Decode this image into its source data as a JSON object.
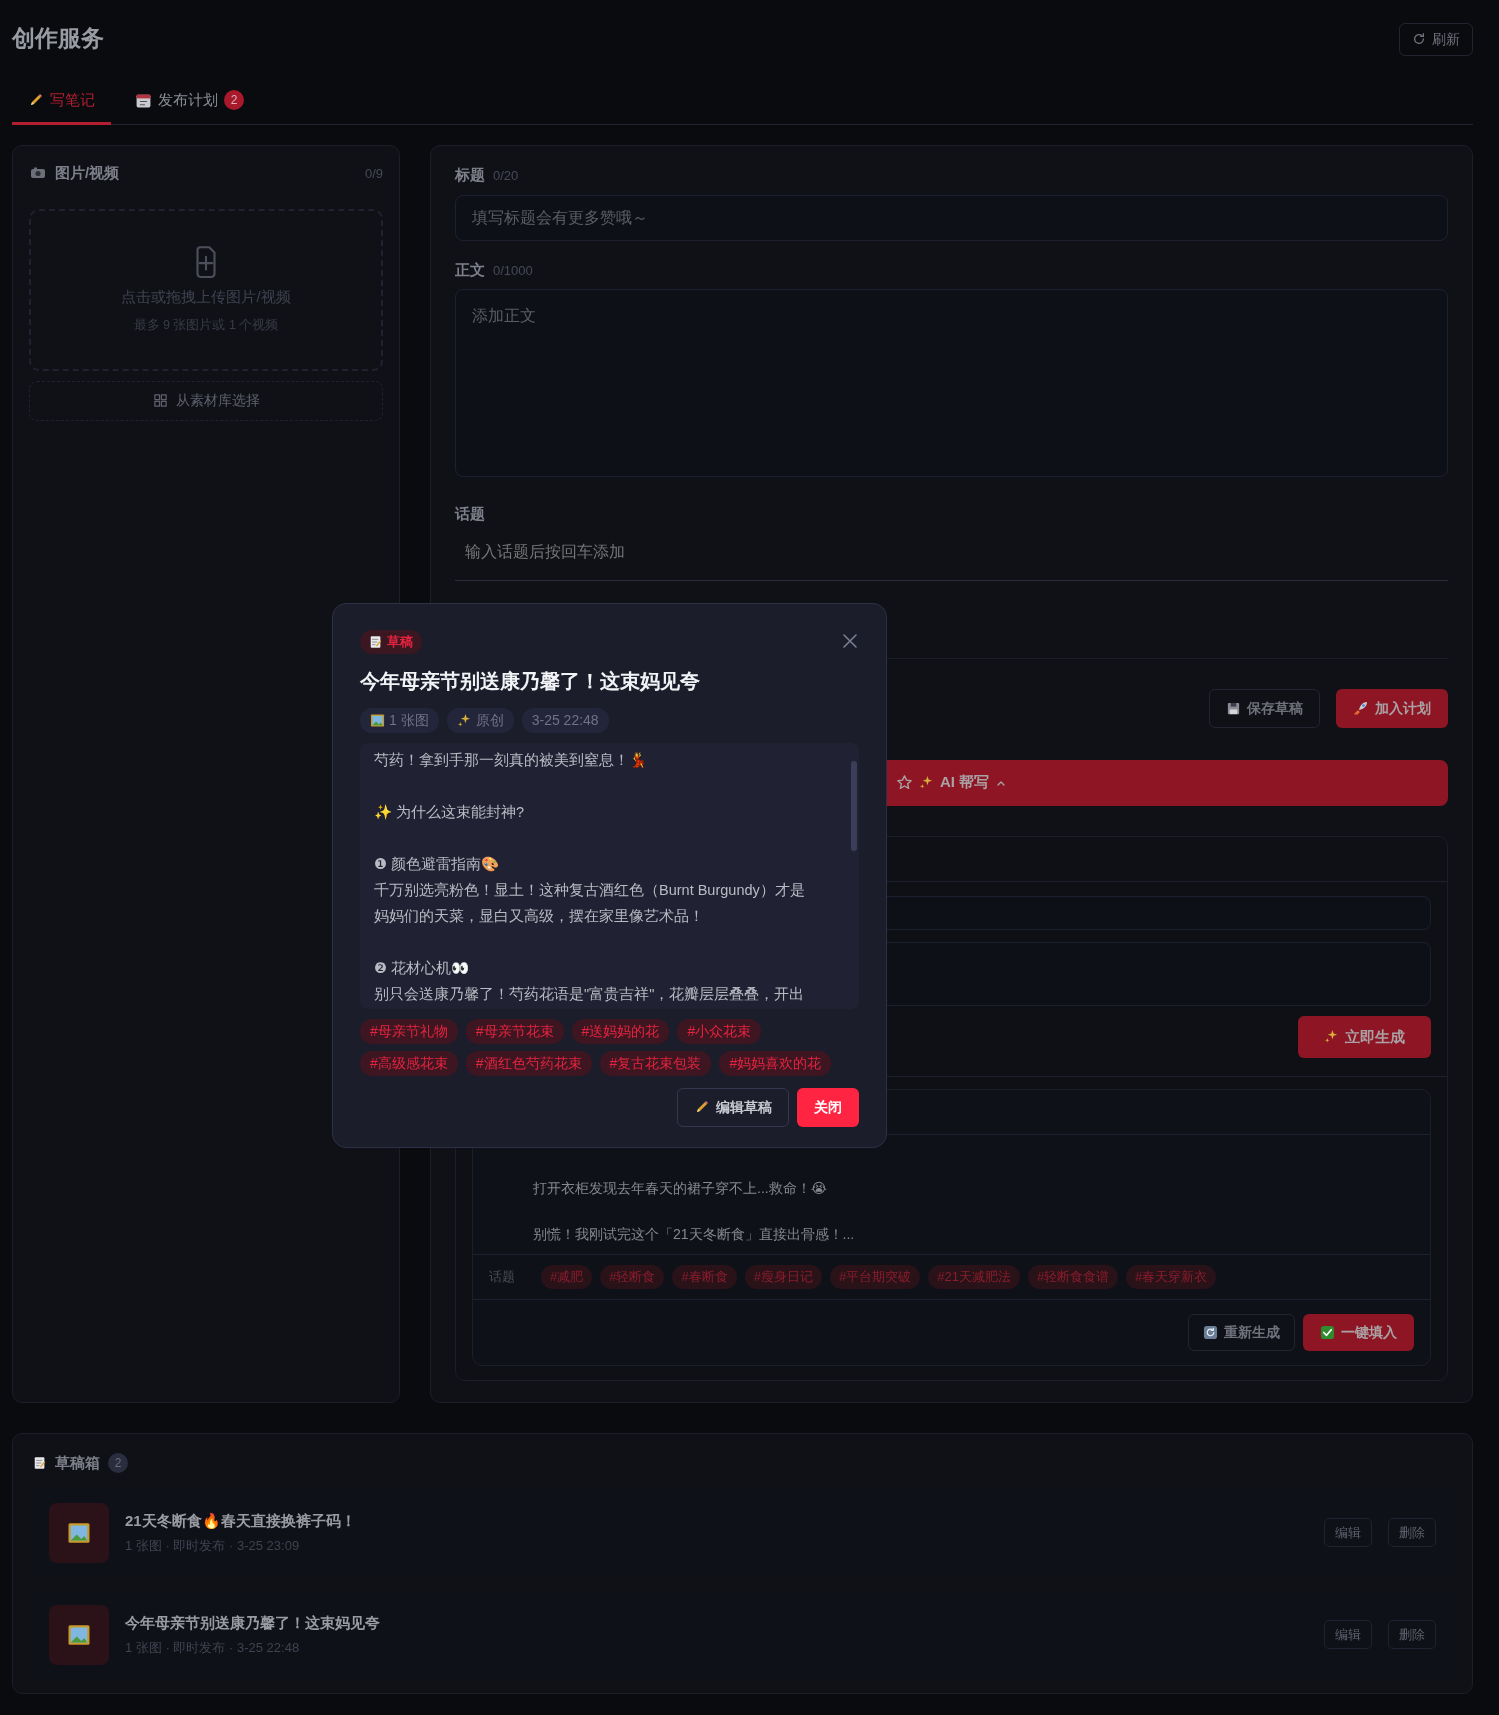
{
  "header": {
    "title": "创作服务",
    "refresh_button": "刷新"
  },
  "tabs": [
    {
      "label": "写笔记",
      "selected": true
    },
    {
      "label": "发布计划",
      "selected": false,
      "badge": "2"
    }
  ],
  "media_panel": {
    "title": "图片/视频",
    "count": "0/9",
    "upload_text": "点击或拖拽上传图片/视频",
    "upload_hint": "最多 9 张图片或 1 个视频",
    "library_button": "从素材库选择"
  },
  "editor": {
    "title_label": "标题",
    "title_count": "0/20",
    "title_placeholder": "填写标题会有更多赞哦～",
    "body_label": "正文",
    "body_count": "0/1000",
    "body_placeholder": "添加正文",
    "topic_label": "话题",
    "topic_placeholder": "输入话题后按回车添加",
    "save_button": "保存草稿",
    "plan_button": "加入计划"
  },
  "ai_helper": {
    "button": "AI 帮写",
    "expanded": true,
    "generate_button": "立即生成",
    "result": {
      "body_lines": [
        "打开衣柜发现去年春天的裙子穿不上...救命！😭",
        "别慌！我刚试完这个「21天冬断食」直接出骨感！..."
      ],
      "topic_label": "话题",
      "topics": [
        "#减肥",
        "#轻断食",
        "#春断食",
        "#瘦身日记",
        "#平台期突破",
        "#21天减肥法",
        "#轻断食食谱",
        "#春天穿新衣"
      ],
      "regenerate_button": "重新生成",
      "fill_button": "一键填入"
    }
  },
  "drafts": {
    "title": "草稿箱",
    "count": "2",
    "items": [
      {
        "title": "21天冬断食🔥春天直接换裤子码！",
        "meta": "1 张图 · 即时发布 · 3-25 23:09",
        "edit_button": "编辑",
        "delete_button": "删除"
      },
      {
        "title": "今年母亲节别送康乃馨了！这束妈见夸",
        "meta": "1 张图 · 即时发布 · 3-25 22:48",
        "edit_button": "编辑",
        "delete_button": "删除"
      }
    ]
  },
  "modal": {
    "badge": "草稿",
    "title": "今年母亲节别送康乃馨了！这束妈见夸",
    "meta": [
      {
        "kind": "images",
        "text": "1 张图"
      },
      {
        "kind": "original",
        "text": "原创"
      },
      {
        "kind": "time",
        "text": "3-25 22:48"
      }
    ],
    "body": "芍药！拿到手那一刻真的被美到窒息！💃\n\n✨ 为什么这束能封神?\n\n❶ 颜色避雷指南🎨\n千万别选亮粉色！显土！这种复古酒红色（Burnt Burgundy）才是妈妈们的天菜，显白又高级，摆在家里像艺术品！\n\n❷ 花材心机👀\n别只会送康乃馨了！芍药花语是\"富贵吉祥\"，花瓣层层叠叠，开出",
    "topics": [
      "#母亲节礼物",
      "#母亲节花束",
      "#送妈妈的花",
      "#小众花束",
      "#高级感花束",
      "#酒红色芍药花束",
      "#复古花束包装",
      "#妈妈喜欢的花"
    ],
    "edit_button": "编辑草稿",
    "close_button": "关闭"
  }
}
